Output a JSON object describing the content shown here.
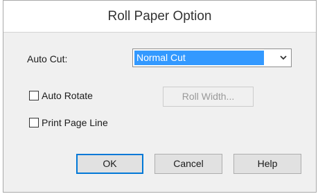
{
  "dialog": {
    "title": "Roll Paper Option"
  },
  "auto_cut": {
    "label": "Auto Cut:",
    "selected_value": "Normal Cut",
    "arrow_icon": "chevron-down-icon"
  },
  "auto_rotate": {
    "label": "Auto Rotate",
    "checked": false
  },
  "roll_width_button": {
    "label": "Roll Width...",
    "enabled": false
  },
  "print_page_line": {
    "label": "Print Page Line",
    "checked": false
  },
  "buttons": {
    "ok": "OK",
    "cancel": "Cancel",
    "help": "Help"
  },
  "colors": {
    "selection": "#3399ff",
    "default_button_border": "#0078d7",
    "dialog_background": "#f0f0f0"
  }
}
